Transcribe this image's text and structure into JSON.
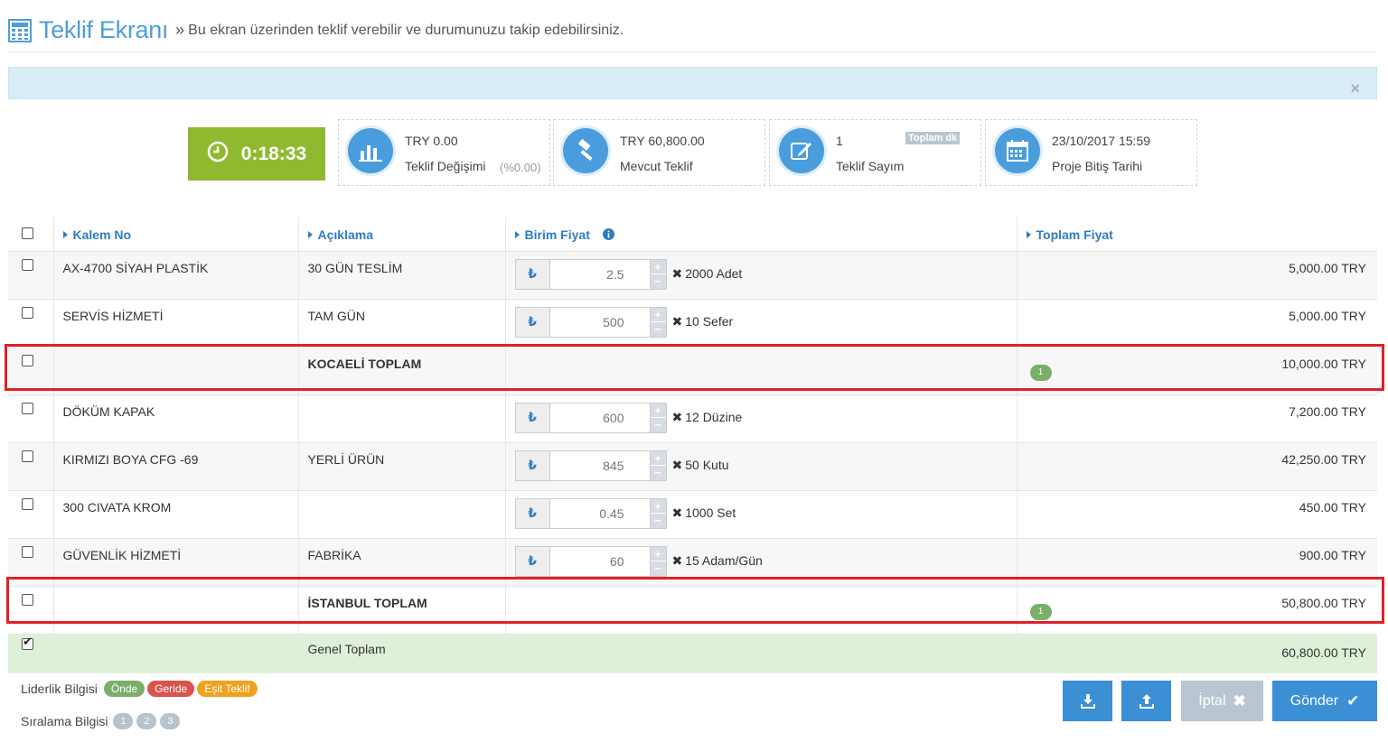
{
  "header": {
    "title": "Teklif Ekranı",
    "separator": "»",
    "subtitle": "Bu ekran üzerinden teklif verebilir ve durumunuzu takip edebilirsiniz."
  },
  "alert": {
    "close": "×"
  },
  "timer": {
    "value": "0:18:33"
  },
  "stats": {
    "change": {
      "value": "TRY 0.00",
      "label": "Teklif Değişimi",
      "percent": "(%0.00)"
    },
    "current": {
      "value": "TRY 60,800.00",
      "label": "Mevcut Teklif"
    },
    "count": {
      "value": "1",
      "label": "Teklif Sayım",
      "tag": "Toplam dk"
    },
    "end": {
      "value": "23/10/2017 15:59",
      "label": "Proje Bitiş Tarihi"
    }
  },
  "table": {
    "headers": {
      "code": "Kalem No",
      "desc": "Açıklama",
      "unit_price": "Birim Fiyat",
      "total": "Toplam Fiyat"
    },
    "currency_symbol": "₺",
    "rows": [
      {
        "code": "AX-4700 SİYAH PLASTİK",
        "desc": "30 GÜN TESLİM",
        "price": "2.5",
        "qty": "2000 Adet",
        "total": "5,000.00 TRY"
      },
      {
        "code": "SERVİS HİZMETİ",
        "desc": "TAM GÜN",
        "price": "500",
        "qty": "10 Sefer",
        "total": "5,000.00 TRY"
      },
      {
        "code": "",
        "desc": "KOCAELİ TOPLAM",
        "badge": "1",
        "total": "10,000.00 TRY"
      },
      {
        "code": "DÖKÜM KAPAK",
        "desc": "",
        "price": "600",
        "qty": "12 Düzine",
        "total": "7,200.00 TRY"
      },
      {
        "code": "KIRMIZI BOYA CFG -69",
        "desc": "YERLİ ÜRÜN",
        "price": "845",
        "qty": "50 Kutu",
        "total": "42,250.00 TRY"
      },
      {
        "code": "300 CIVATA KROM",
        "desc": "",
        "price": "0.45",
        "qty": "1000 Set",
        "total": "450.00 TRY"
      },
      {
        "code": "GÜVENLİK HİZMETİ",
        "desc": "FABRİKA",
        "price": "60",
        "qty": "15 Adam/Gün",
        "total": "900.00 TRY"
      },
      {
        "code": "",
        "desc": "İSTANBUL TOPLAM",
        "badge": "1",
        "total": "50,800.00 TRY"
      }
    ],
    "grand": {
      "desc": "Genel Toplam",
      "total": "60,800.00 TRY"
    }
  },
  "legend": {
    "leader_label": "Liderlik Bilgisi",
    "ahead": "Önde",
    "behind": "Geride",
    "equal": "Eşit Teklif",
    "rank_label": "Sıralama Bilgisi",
    "ranks": [
      "1",
      "2",
      "3"
    ]
  },
  "buttons": {
    "cancel": "İptal",
    "send": "Gönder"
  },
  "colors": {
    "primary": "#3b8fd4",
    "timer": "#8fba2f",
    "ahead": "#7bae6a",
    "behind": "#d9534f",
    "equal": "#f0a11d",
    "highlight": "#e0202a"
  }
}
